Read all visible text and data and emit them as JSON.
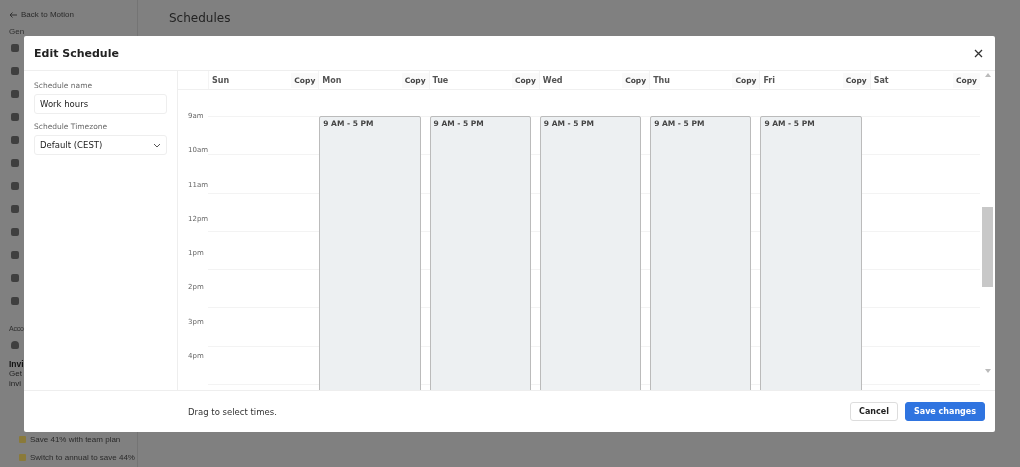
{
  "background": {
    "back_link": "Back to Motion",
    "page_title": "Schedules",
    "section_general": "Gen",
    "section_account": "Acco",
    "invite_title": "Invi",
    "invite_text": [
      "Get",
      "invi"
    ],
    "promos": [
      "Save 41% with team plan",
      "Switch to annual to save 44%"
    ]
  },
  "dialog": {
    "title": "Edit Schedule",
    "fields": [
      {
        "label": "Schedule name",
        "kind": "text",
        "value": "Work hours"
      },
      {
        "label": "Schedule Timezone",
        "kind": "select",
        "value": "Default (CEST)"
      }
    ],
    "times": [
      "9am",
      "10am",
      "11am",
      "12pm",
      "1pm",
      "2pm",
      "3pm",
      "4pm"
    ],
    "days": [
      {
        "name": "Sun",
        "copy": "Copy"
      },
      {
        "name": "Mon",
        "copy": "Copy",
        "blocks": [
          {
            "label": "9 AM - 5 PM"
          }
        ]
      },
      {
        "name": "Tue",
        "copy": "Copy",
        "blocks": [
          {
            "label": "9 AM - 5 PM"
          }
        ]
      },
      {
        "name": "Wed",
        "copy": "Copy",
        "blocks": [
          {
            "label": "9 AM - 5 PM"
          }
        ]
      },
      {
        "name": "Thu",
        "copy": "Copy",
        "blocks": [
          {
            "label": "9 AM - 5 PM"
          }
        ]
      },
      {
        "name": "Fri",
        "copy": "Copy",
        "blocks": [
          {
            "label": "9 AM - 5 PM"
          }
        ]
      },
      {
        "name": "Sat",
        "copy": "Copy"
      }
    ],
    "hint": "Drag to select times.",
    "buttons": [
      {
        "label": "Cancel",
        "kind": "secondary"
      },
      {
        "label": "Save changes",
        "kind": "primary"
      }
    ]
  }
}
